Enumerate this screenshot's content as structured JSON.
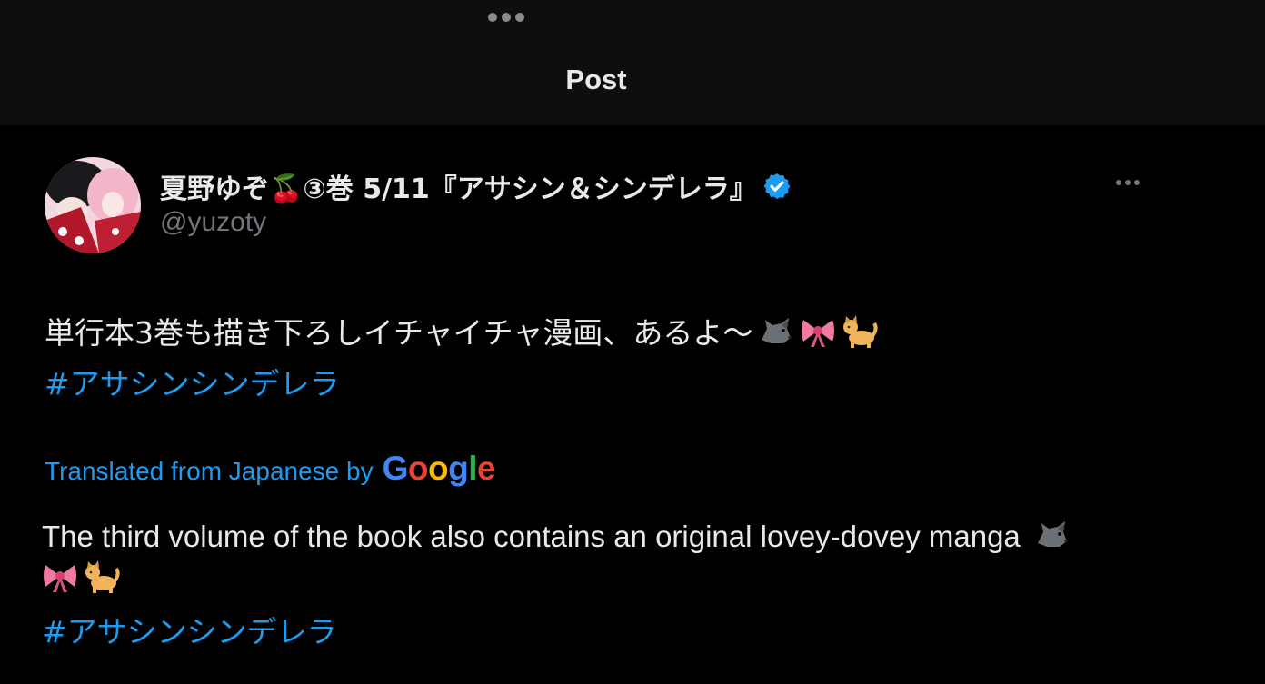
{
  "header": {
    "title": "Post"
  },
  "author": {
    "name": "夏野ゆぞ🍒③巻 5/11『アサシン＆シンデレラ』",
    "handle": "@yuzoty",
    "verified_color": "#1d9bf0"
  },
  "post": {
    "text": "単行本3巻も描き下ろしイチャイチャ漫画、あるよ〜",
    "emojis": [
      "wolf-icon",
      "ribbon-icon",
      "cat-icon"
    ],
    "hashtag": "#アサシンシンデレラ"
  },
  "translation": {
    "label": "Translated from Japanese by",
    "provider": "Google",
    "text": "The third volume of the book also contains an original lovey-dovey manga",
    "hashtag": "#アサシンシンデレラ"
  },
  "colors": {
    "link": "#1d9bf0",
    "text": "#e7e9ea",
    "muted": "#71767b",
    "background": "#000000",
    "header_bg": "#0e0e0e"
  }
}
